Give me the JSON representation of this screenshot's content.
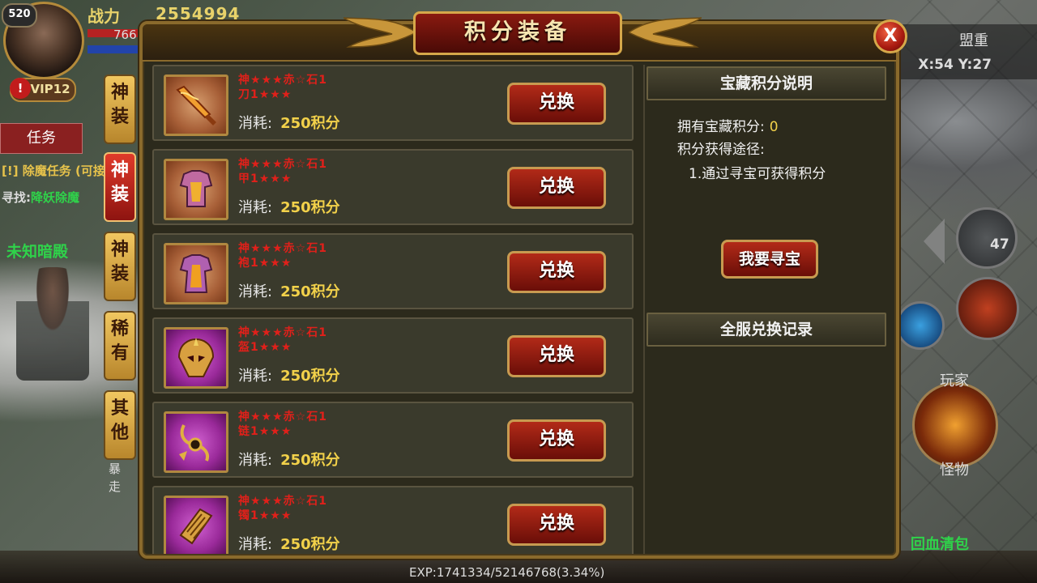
{
  "hud": {
    "level": "520",
    "power_label": "战力",
    "power_value": "2554994",
    "hp_partial": "766",
    "vip": "VIP12",
    "vip_alert": "!",
    "task_tab": "任务",
    "quest_line1": "[!] 除魔任务 (可接",
    "quest_line2_prefix": "寻找:",
    "quest_line2_target": "降妖除魔",
    "map_name": "未知暗殿",
    "server": "盟重",
    "coords": "X:54 Y:27",
    "skill_count": "47",
    "label_player": "玩家",
    "label_monster": "怪物",
    "label_heal": "回血清包",
    "label_auto": "暴走",
    "exp": "EXP:1741334/52146768(3.34%)"
  },
  "side_tabs": [
    {
      "label_top": "神",
      "label_bottom": "装",
      "active": false
    },
    {
      "label_top": "神",
      "label_bottom": "装",
      "active": true
    },
    {
      "label_top": "神",
      "label_bottom": "装",
      "active": false
    },
    {
      "label_top": "稀",
      "label_bottom": "有",
      "active": false
    },
    {
      "label_top": "其",
      "label_bottom": "他",
      "active": false
    }
  ],
  "panel": {
    "title": "积分装备",
    "close": "X"
  },
  "items": [
    {
      "name_line1": "神★★★赤☆石1",
      "name_line2": "刀1★★★",
      "cost_label": "消耗:",
      "cost_value": "250积分",
      "button": "兑换",
      "icon": "sword-icon",
      "frame": "orange"
    },
    {
      "name_line1": "神★★★赤☆石1",
      "name_line2": "甲1★★★",
      "cost_label": "消耗:",
      "cost_value": "250积分",
      "button": "兑换",
      "icon": "armor-icon",
      "frame": "orange"
    },
    {
      "name_line1": "神★★★赤☆石1",
      "name_line2": "袍1★★★",
      "cost_label": "消耗:",
      "cost_value": "250积分",
      "button": "兑换",
      "icon": "robe-icon",
      "frame": "orange"
    },
    {
      "name_line1": "神★★★赤☆石1",
      "name_line2": "盔1★★★",
      "cost_label": "消耗:",
      "cost_value": "250积分",
      "button": "兑换",
      "icon": "helmet-icon",
      "frame": "purple"
    },
    {
      "name_line1": "神★★★赤☆石1",
      "name_line2": "链1★★★",
      "cost_label": "消耗:",
      "cost_value": "250积分",
      "button": "兑换",
      "icon": "necklace-icon",
      "frame": "purple"
    },
    {
      "name_line1": "神★★★赤☆石1",
      "name_line2": "镯1★★★",
      "cost_label": "消耗:",
      "cost_value": "250积分",
      "button": "兑换",
      "icon": "bracelet-icon",
      "frame": "purple"
    }
  ],
  "info": {
    "header": "宝藏积分说明",
    "points_label": "拥有宝藏积分:",
    "points_value": "0",
    "ways_label": "积分获得途径:",
    "way1": "1.通过寻宝可获得积分",
    "seek_button": "我要寻宝",
    "record_header": "全服兑换记录"
  },
  "colors": {
    "accent_gold": "#f2d14a",
    "item_name_red": "#e0201a",
    "button_red": "#b22a18",
    "frame_gold": "#d6a84a"
  }
}
